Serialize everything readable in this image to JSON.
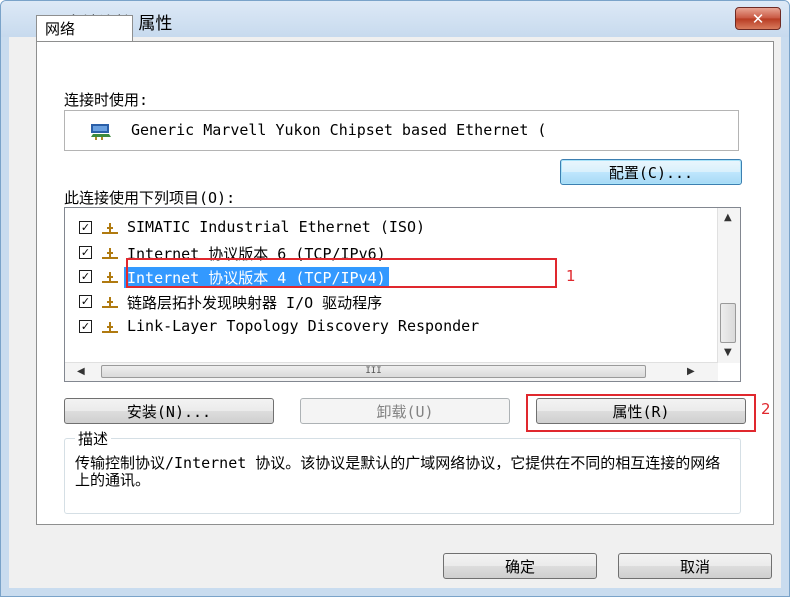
{
  "window": {
    "title": "本地连接 属性",
    "close_label": "✕"
  },
  "tabs": [
    {
      "label": "网络"
    }
  ],
  "connect_using": {
    "label": "连接时使用:",
    "adapter": "Generic Marvell Yukon Chipset based Ethernet (",
    "configure_button": "配置(C)..."
  },
  "items_section": {
    "label": "此连接使用下列项目(O):",
    "items": [
      {
        "label": "SIMATIC Industrial Ethernet (ISO)",
        "checked": true,
        "selected": false
      },
      {
        "label": "Internet 协议版本 6 (TCP/IPv6)",
        "checked": true,
        "selected": false
      },
      {
        "label": "Internet 协议版本 4 (TCP/IPv4)",
        "checked": true,
        "selected": true
      },
      {
        "label": "链路层拓扑发现映射器 I/O 驱动程序",
        "checked": true,
        "selected": false
      },
      {
        "label": "Link-Layer Topology Discovery Responder",
        "checked": true,
        "selected": false
      }
    ],
    "hscroll_grip": "III"
  },
  "buttons": {
    "install": "安装(N)...",
    "uninstall": "卸载(U)",
    "properties": "属性(R)",
    "ok": "确定",
    "cancel": "取消"
  },
  "description": {
    "title": "描述",
    "text": "传输控制协议/Internet 协议。该协议是默认的广域网络协议，它提供在不同的相互连接的网络上的通讯。"
  },
  "annotations": {
    "marker_1": "1",
    "marker_2": "2",
    "color": "#e0282e"
  },
  "colors": {
    "selection": "#3399ff",
    "titlebar": "#c9dcef",
    "close": "#c8553f"
  },
  "icons": {
    "title": "network-connection-icon",
    "adapter": "network-adapter-icon",
    "protocol": "protocol-icon"
  }
}
